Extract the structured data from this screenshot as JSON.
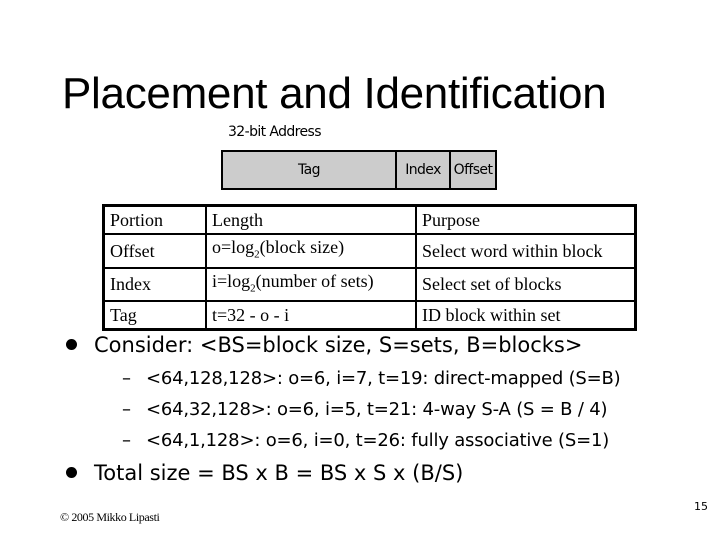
{
  "slide": {
    "title": "Placement and Identification",
    "address": {
      "label": "32-bit Address",
      "fields": [
        "Tag",
        "Index",
        "Offset"
      ]
    },
    "table": {
      "headers": [
        "Portion",
        "Length",
        "Purpose"
      ],
      "rows": [
        {
          "portion": "Offset",
          "length_prefix": "o=log",
          "length_sub": "2",
          "length_suffix": "(block size)",
          "purpose": "Select word within block"
        },
        {
          "portion": "Index",
          "length_prefix": "i=log",
          "length_sub": "2",
          "length_suffix": "(number of sets)",
          "purpose": "Select set of blocks"
        },
        {
          "portion": "Tag",
          "length_prefix": "t=32 - o - i",
          "length_sub": "",
          "length_suffix": "",
          "purpose": "ID block within set"
        }
      ]
    },
    "bullets": [
      {
        "text": "Consider: <BS=block size, S=sets, B=blocks>",
        "sub": [
          "<64,128,128>: o=6, i=7, t=19: direct-mapped (S=B)",
          "<64,32,128>: o=6, i=5, t=21: 4-way S-A (S = B / 4)",
          "<64,1,128>: o=6, i=0, t=26: fully associative (S=1)"
        ]
      },
      {
        "text": "Total size = BS x B = BS x S x (B/S)",
        "sub": []
      }
    ],
    "sub_marker": "–",
    "footer": "© 2005 Mikko Lipasti",
    "page_number": "15"
  }
}
